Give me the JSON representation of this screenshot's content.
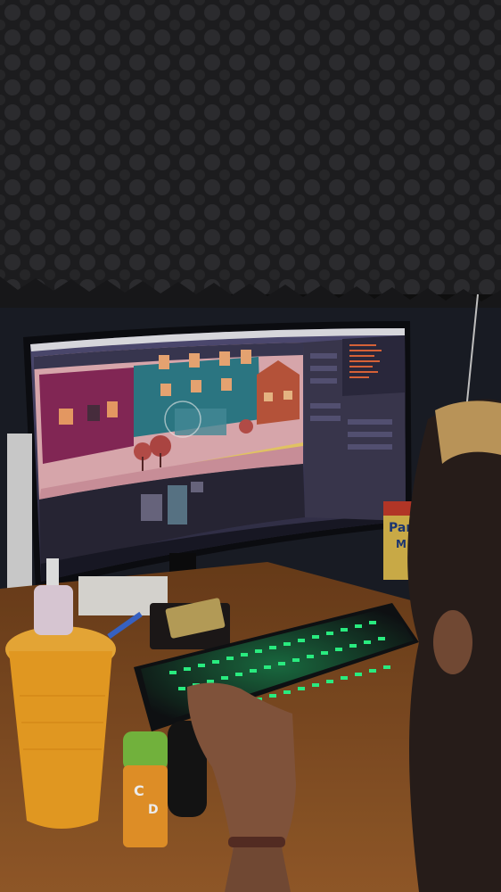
{
  "photo": {
    "subject": "",
    "scene_text": {
      "snack_box_label": "Par",
      "snack_box_label_2": "M",
      "spray_bottle_label": "C",
      "spray_bottle_label_2": "D"
    }
  },
  "colors": {
    "wall_foam": "#2a2a2c",
    "monitor_bezel": "#0d0e12",
    "ui_panel": "#3d3a52",
    "street_pink": "#e7b0b8",
    "building_magenta": "#8c2a5c",
    "building_teal": "#2f7f8c",
    "building_orange": "#c45a3e",
    "keyboard_glow": "#2dff8a",
    "desk_wood": "#8a5226",
    "cup_orange": "#f4a424",
    "bottle_green": "#7bc142"
  },
  "icons": {
    "viewport": "3d-viewport-icon",
    "outliner": "outliner-icon",
    "properties": "properties-icon"
  }
}
